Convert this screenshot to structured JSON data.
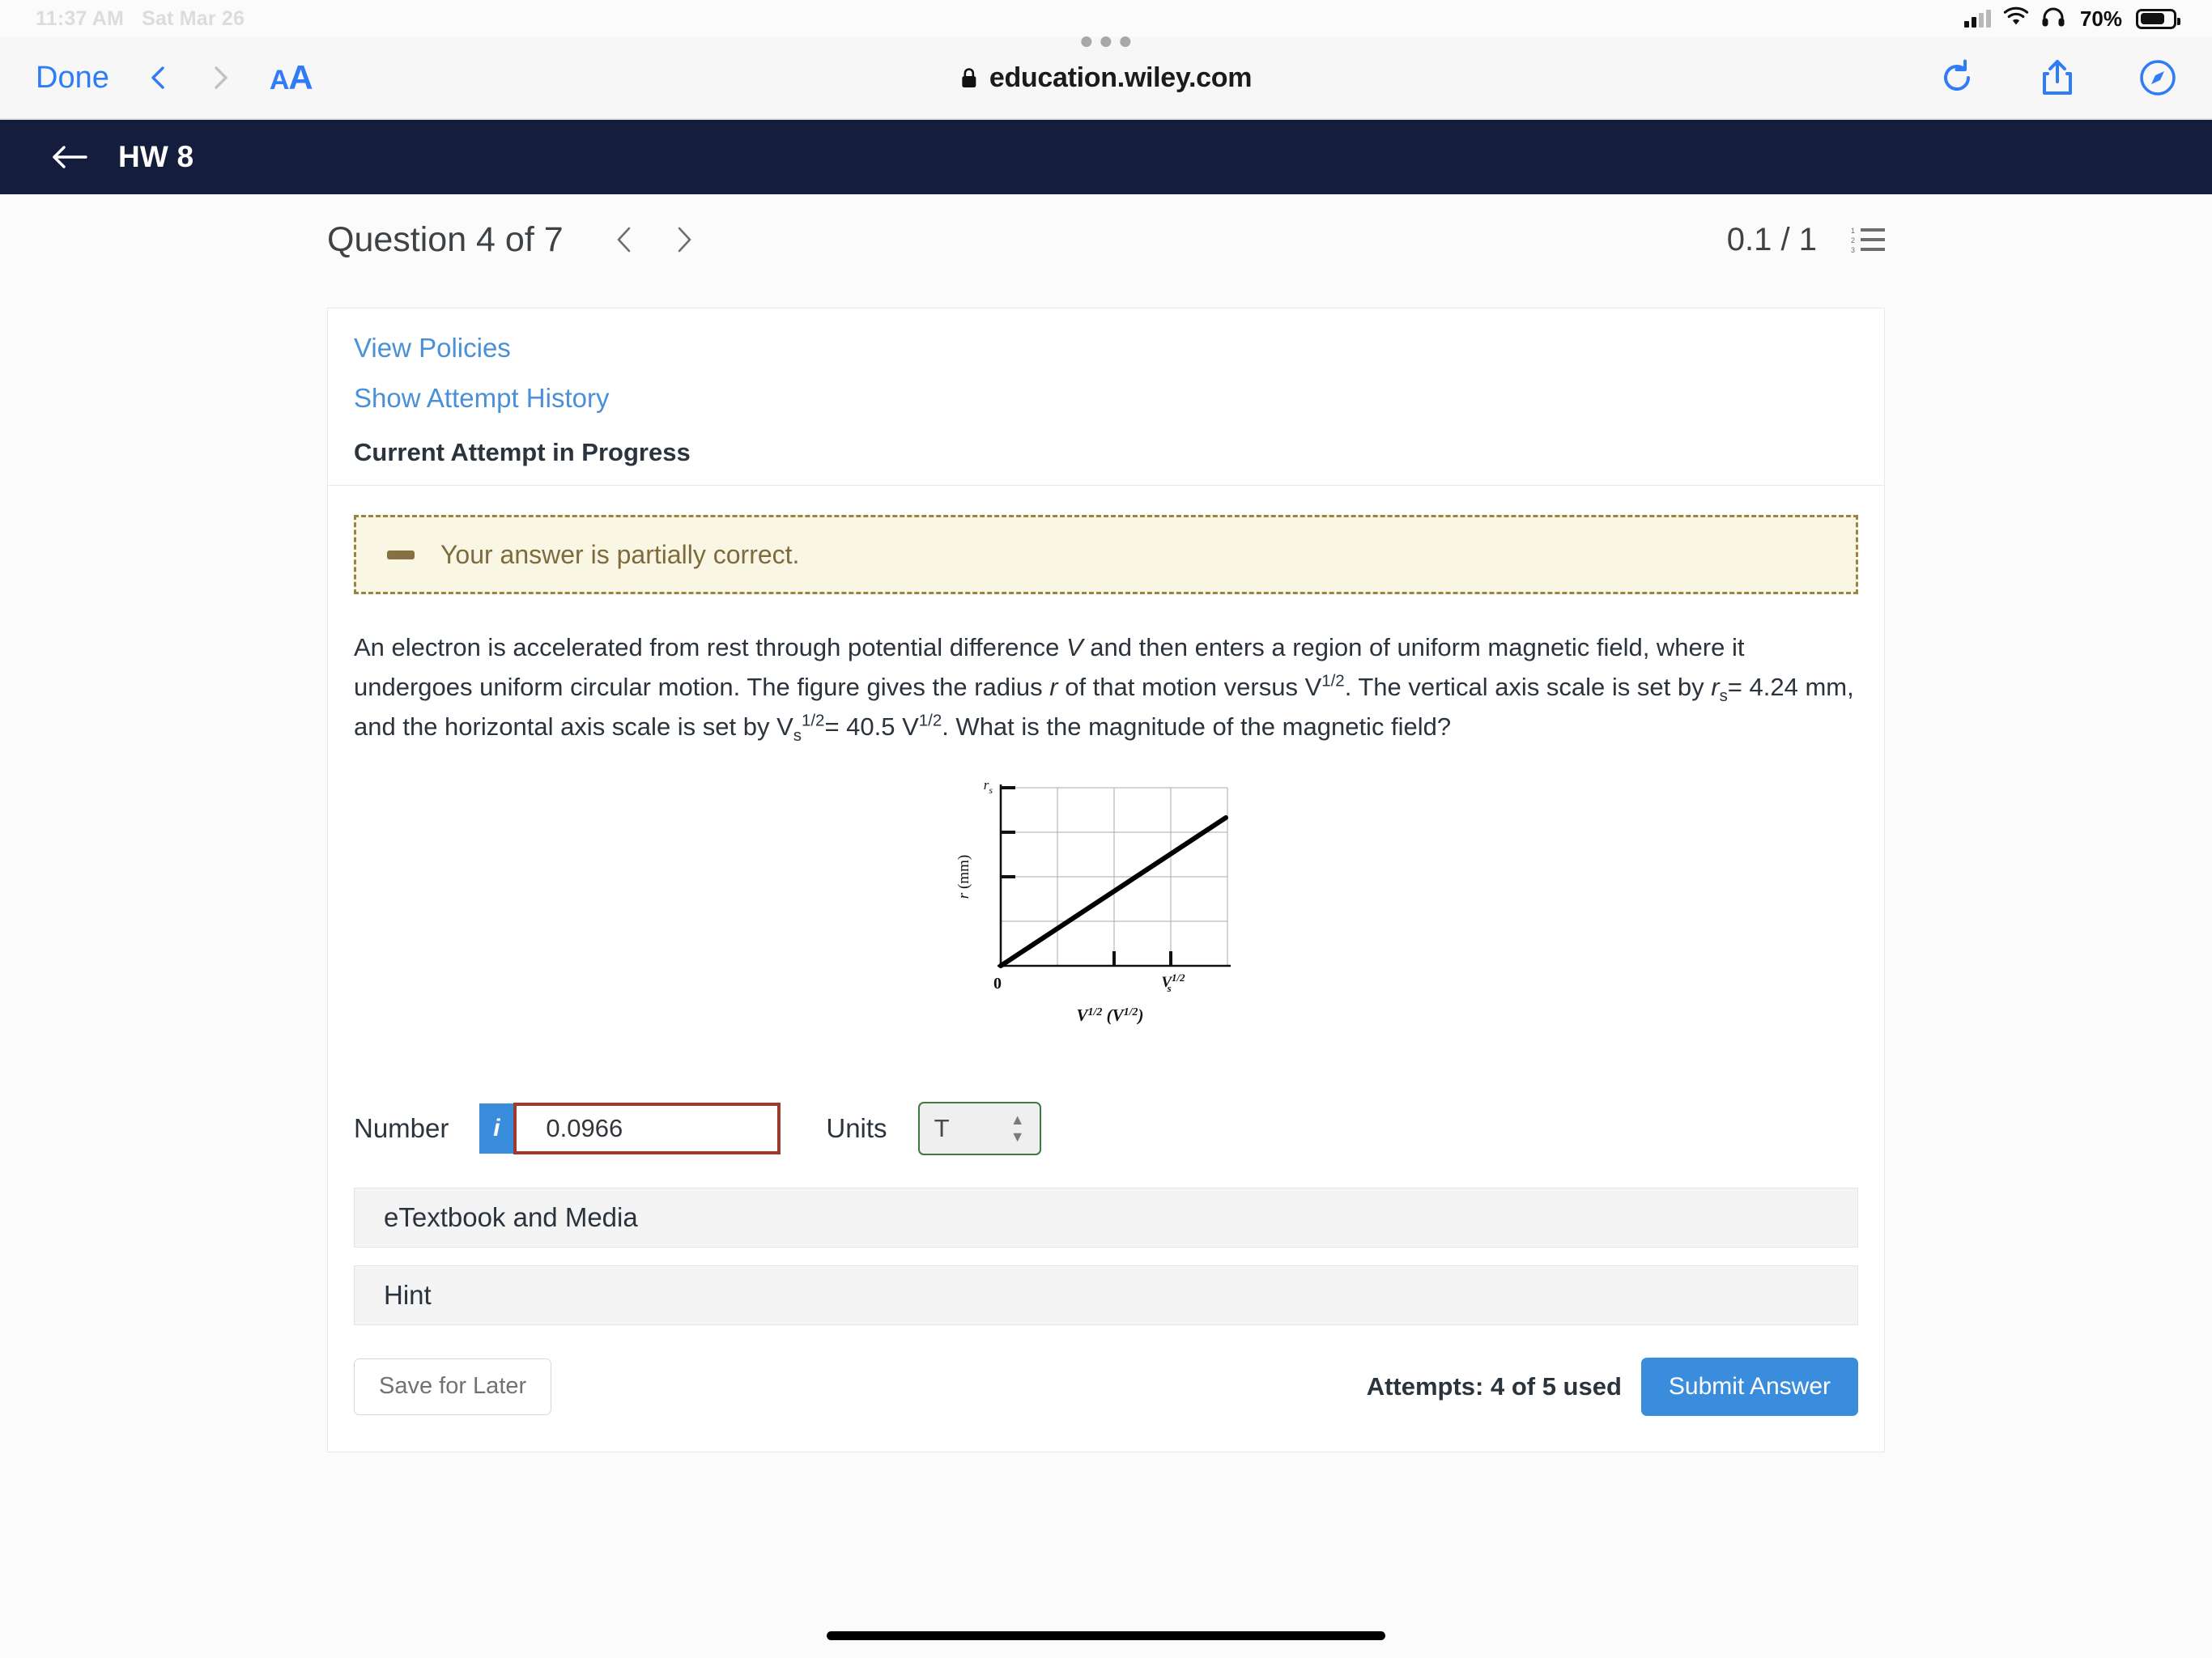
{
  "status_bar": {
    "time": "11:37 AM",
    "date": "Sat Mar 26",
    "battery_percent": "70%",
    "icons": [
      "signal-icon",
      "wifi-icon",
      "headphones-icon",
      "battery-icon"
    ]
  },
  "browser": {
    "done_label": "Done",
    "back_icon": "chevron-left-icon",
    "forward_icon": "chevron-right-icon",
    "text_size_label": "AA",
    "url": "education.wiley.com",
    "secure_icon": "lock-icon",
    "tab_overview_icon": "three-dots-icon",
    "reload_icon": "reload-icon",
    "share_icon": "share-icon",
    "safari_icon": "compass-icon"
  },
  "app_header": {
    "back_icon": "arrow-left-icon",
    "title": "HW 8"
  },
  "question_header": {
    "title": "Question 4 of 7",
    "prev_icon": "chevron-left-icon",
    "next_icon": "chevron-right-icon",
    "score": "0.1 / 1",
    "list_icon": "numbered-list-icon"
  },
  "card": {
    "view_policies": "View Policies",
    "show_attempt_history": "Show Attempt History",
    "current_attempt": "Current Attempt in Progress"
  },
  "alert": {
    "icon": "dash-icon",
    "message": "Your answer is partially correct.",
    "border_color": "#9a8442",
    "background_color": "#faf6e4",
    "text_color": "#7d6a3d"
  },
  "question": {
    "part1": "An electron is accelerated from rest through potential difference ",
    "v_italic": "V",
    "part2": " and then enters a region of uniform magnetic field, where it undergoes uniform circular motion. The figure gives the radius ",
    "r_italic": "r",
    "part3": " of that motion versus ",
    "v2": "V",
    "exp1": "1/2",
    "part4": ". The vertical axis scale is set by ",
    "rs_base": "r",
    "rs_sub": "s",
    "part5": "= 4.24 mm, and the horizontal axis scale is set by V",
    "vs_sub": "s",
    "vs_exp": "1/2",
    "part6": "= 40.5 V",
    "exp2": "1/2",
    "part7": ". What is the magnitude of the magnetic field?"
  },
  "chart_data": {
    "type": "line",
    "title": "",
    "xlabel": "V^1/2 (V^1/2)",
    "ylabel": "r (mm)",
    "x_origin_label": "0",
    "x_max_tick_label": "V_s^1/2",
    "y_max_tick_label": "r_s",
    "xlim": [
      0,
      54
    ],
    "ylim": [
      0,
      4.24
    ],
    "x_scale_value": 40.5,
    "y_scale_value": 4.24,
    "grid": true,
    "grid_columns": 4,
    "grid_rows": 4,
    "series": [
      {
        "name": "r vs V^1/2",
        "x": [
          0,
          54
        ],
        "y": [
          0,
          4.24
        ]
      }
    ],
    "line_color": "#000000",
    "legend": "none"
  },
  "answer": {
    "number_label": "Number",
    "info_icon": "info-icon",
    "number_value": "0.0966",
    "number_border_color": "#9e3b2f",
    "units_label": "Units",
    "units_value": "T",
    "units_border_color": "#3f7a3f",
    "stepper_icon": "up-down-chevron-icon"
  },
  "accordions": [
    {
      "label": "eTextbook and Media"
    },
    {
      "label": "Hint"
    }
  ],
  "footer": {
    "save_label": "Save for Later",
    "attempts": "Attempts: 4 of 5 used",
    "submit_label": "Submit Answer",
    "submit_color": "#3a8ddc"
  }
}
